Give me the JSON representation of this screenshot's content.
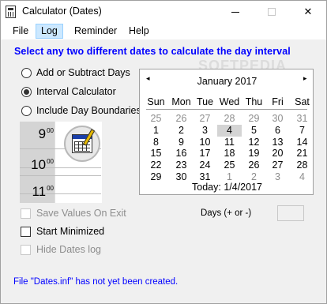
{
  "window": {
    "title": "Calculator (Dates)"
  },
  "menu": [
    "File",
    "Log",
    "Reminder",
    "Help"
  ],
  "headline": "Select any two different dates to calculate the day interval",
  "modes": [
    {
      "label": "Add or Subtract Days",
      "checked": false
    },
    {
      "label": "Interval Calculator",
      "checked": true
    },
    {
      "label": "Include Day Boundaries",
      "checked": false
    }
  ],
  "times": [
    {
      "hour": "9",
      "minutes": "00"
    },
    {
      "hour": "10",
      "minutes": "00"
    },
    {
      "hour": "11",
      "minutes": "00"
    }
  ],
  "options": [
    {
      "label": "Save Values On Exit",
      "checked": false,
      "enabled": false
    },
    {
      "label": "Start Minimized",
      "checked": false,
      "enabled": true
    },
    {
      "label": "Hide Dates log",
      "checked": false,
      "enabled": false
    }
  ],
  "calendar": {
    "month": "January 2017",
    "prev": "◂",
    "next": "▸",
    "days_of_week": [
      "Sun",
      "Mon",
      "Tue",
      "Wed",
      "Thu",
      "Fri",
      "Sat"
    ],
    "weeks": [
      [
        "25",
        "26",
        "27",
        "28",
        "29",
        "30",
        "31"
      ],
      [
        "1",
        "2",
        "3",
        "4",
        "5",
        "6",
        "7"
      ],
      [
        "8",
        "9",
        "10",
        "11",
        "12",
        "13",
        "14"
      ],
      [
        "15",
        "16",
        "17",
        "18",
        "19",
        "20",
        "21"
      ],
      [
        "22",
        "23",
        "24",
        "25",
        "26",
        "27",
        "28"
      ],
      [
        "29",
        "30",
        "31",
        "1",
        "2",
        "3",
        "4"
      ]
    ],
    "selected": "4",
    "today": "Today: 1/4/2017"
  },
  "days_label": "Days (+ or -)",
  "days_value": "",
  "status": "File \"Dates.inf\" has not yet been created.",
  "watermark": "SOFTPEDIA",
  "colors": {
    "accent_text": "#0000ff",
    "menu_highlight": "#cce8ff"
  }
}
